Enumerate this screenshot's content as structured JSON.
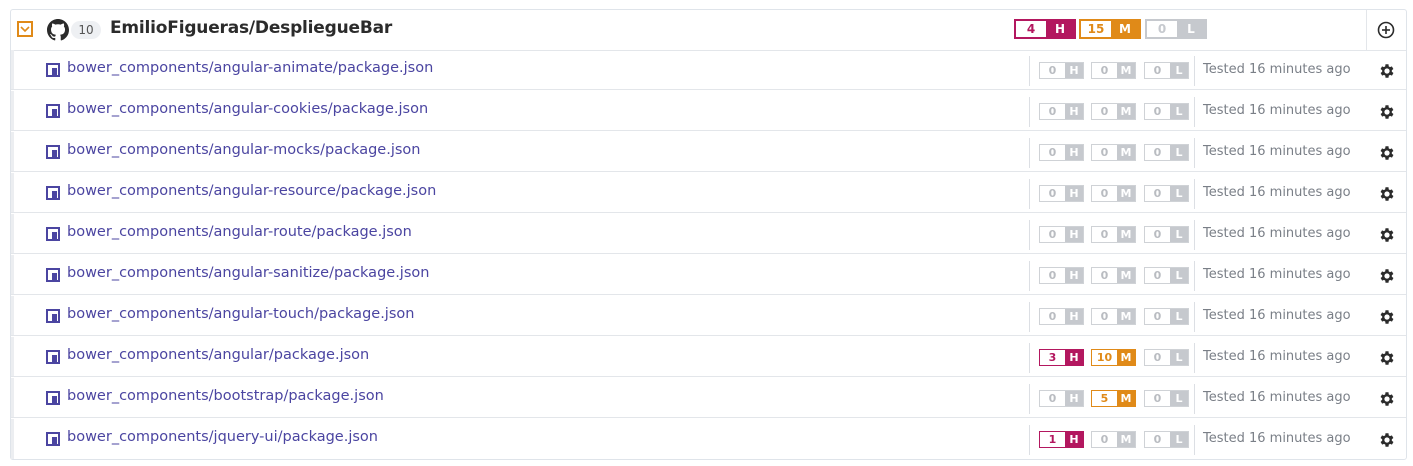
{
  "project": {
    "name": "EmilioFigueras/DespliegueBar",
    "target_count": "10",
    "icons": {
      "collapse": "chevron-down-icon",
      "source": "github-icon",
      "add": "plus-circle-icon"
    },
    "severity": {
      "high": "4",
      "high_label": "H",
      "medium": "15",
      "medium_label": "M",
      "low": "0",
      "low_label": "L"
    }
  },
  "colors": {
    "high": "#b3175f",
    "medium": "#e08a18",
    "inactive": "#c6c9ce",
    "link": "#4b45a1"
  },
  "rows": [
    {
      "file": "bower_components/angular-animate/package.json",
      "high": "0",
      "medium": "0",
      "low": "0",
      "tested": "Tested 16 minutes ago"
    },
    {
      "file": "bower_components/angular-cookies/package.json",
      "high": "0",
      "medium": "0",
      "low": "0",
      "tested": "Tested 16 minutes ago"
    },
    {
      "file": "bower_components/angular-mocks/package.json",
      "high": "0",
      "medium": "0",
      "low": "0",
      "tested": "Tested 16 minutes ago"
    },
    {
      "file": "bower_components/angular-resource/package.json",
      "high": "0",
      "medium": "0",
      "low": "0",
      "tested": "Tested 16 minutes ago"
    },
    {
      "file": "bower_components/angular-route/package.json",
      "high": "0",
      "medium": "0",
      "low": "0",
      "tested": "Tested 16 minutes ago"
    },
    {
      "file": "bower_components/angular-sanitize/package.json",
      "high": "0",
      "medium": "0",
      "low": "0",
      "tested": "Tested 16 minutes ago"
    },
    {
      "file": "bower_components/angular-touch/package.json",
      "high": "0",
      "medium": "0",
      "low": "0",
      "tested": "Tested 16 minutes ago"
    },
    {
      "file": "bower_components/angular/package.json",
      "high": "3",
      "medium": "10",
      "low": "0",
      "tested": "Tested 16 minutes ago"
    },
    {
      "file": "bower_components/bootstrap/package.json",
      "high": "0",
      "medium": "5",
      "low": "0",
      "tested": "Tested 16 minutes ago"
    },
    {
      "file": "bower_components/jquery-ui/package.json",
      "high": "1",
      "medium": "0",
      "low": "0",
      "tested": "Tested 16 minutes ago"
    }
  ],
  "labels": {
    "high": "H",
    "medium": "M",
    "low": "L"
  }
}
